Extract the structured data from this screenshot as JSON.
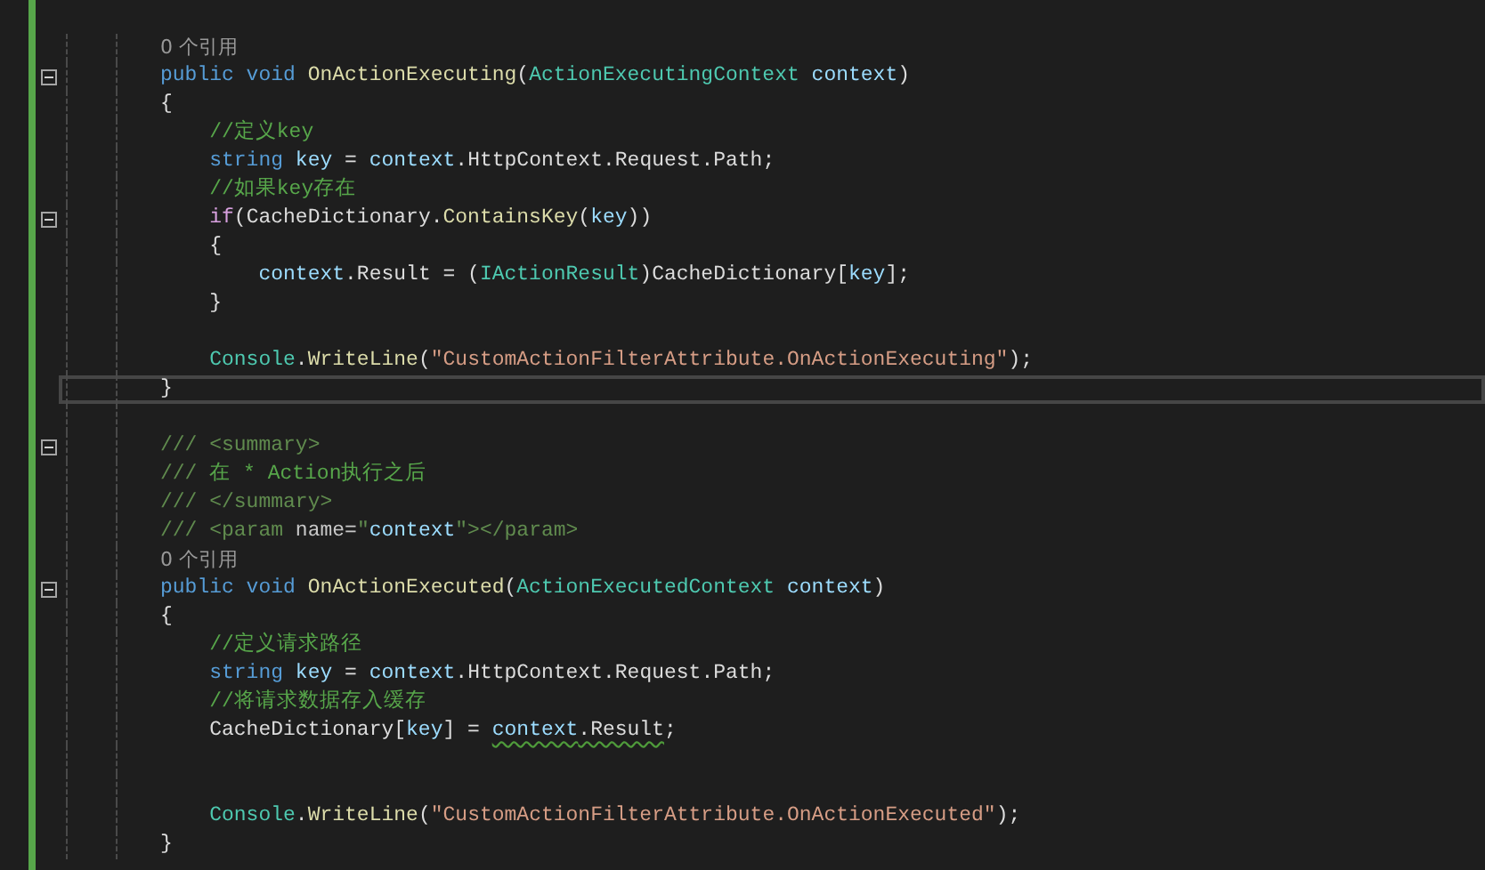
{
  "editor": {
    "lines": [
      {
        "kind": "codelens",
        "text": "0 个引用",
        "fold": false,
        "current": false
      },
      {
        "kind": "code",
        "fold": true,
        "current": false,
        "tokens": [
          {
            "kind": "keyword",
            "text": "public void "
          },
          {
            "kind": "method",
            "text": "OnActionExecuting"
          },
          {
            "kind": "plain",
            "text": "("
          },
          {
            "kind": "type",
            "text": "ActionExecutingContext "
          },
          {
            "kind": "variable",
            "text": "context"
          },
          {
            "kind": "plain",
            "text": ")"
          }
        ]
      },
      {
        "kind": "code",
        "fold": false,
        "current": false,
        "tokens": [
          {
            "kind": "plain",
            "text": "{"
          }
        ]
      },
      {
        "kind": "code",
        "fold": false,
        "current": false,
        "tokens": [
          {
            "kind": "comment",
            "text": "    //定义key"
          }
        ]
      },
      {
        "kind": "code",
        "fold": false,
        "current": false,
        "tokens": [
          {
            "kind": "keyword",
            "text": "    string "
          },
          {
            "kind": "variable",
            "text": "key"
          },
          {
            "kind": "plain",
            "text": " = "
          },
          {
            "kind": "variable",
            "text": "context"
          },
          {
            "kind": "plain",
            "text": ".HttpContext.Request.Path;"
          }
        ]
      },
      {
        "kind": "code",
        "fold": false,
        "current": false,
        "tokens": [
          {
            "kind": "comment",
            "text": "    //如果key存在"
          }
        ]
      },
      {
        "kind": "code",
        "fold": true,
        "current": false,
        "tokens": [
          {
            "kind": "control",
            "text": "    if"
          },
          {
            "kind": "plain",
            "text": "(CacheDictionary."
          },
          {
            "kind": "method",
            "text": "ContainsKey"
          },
          {
            "kind": "plain",
            "text": "("
          },
          {
            "kind": "variable",
            "text": "key"
          },
          {
            "kind": "plain",
            "text": "))"
          }
        ]
      },
      {
        "kind": "code",
        "fold": false,
        "current": false,
        "tokens": [
          {
            "kind": "plain",
            "text": "    {"
          }
        ]
      },
      {
        "kind": "code",
        "fold": false,
        "current": false,
        "tokens": [
          {
            "kind": "variable",
            "text": "        context"
          },
          {
            "kind": "plain",
            "text": ".Result = ("
          },
          {
            "kind": "type",
            "text": "IActionResult"
          },
          {
            "kind": "plain",
            "text": ")CacheDictionary["
          },
          {
            "kind": "variable",
            "text": "key"
          },
          {
            "kind": "plain",
            "text": "];"
          }
        ]
      },
      {
        "kind": "code",
        "fold": false,
        "current": false,
        "tokens": [
          {
            "kind": "plain",
            "text": "    }"
          }
        ]
      },
      {
        "kind": "blank",
        "fold": false,
        "current": false
      },
      {
        "kind": "code",
        "fold": false,
        "current": false,
        "tokens": [
          {
            "kind": "type",
            "text": "    Console"
          },
          {
            "kind": "plain",
            "text": "."
          },
          {
            "kind": "method",
            "text": "WriteLine"
          },
          {
            "kind": "plain",
            "text": "("
          },
          {
            "kind": "string",
            "text": "\"CustomActionFilterAttribute.OnActionExecuting\""
          },
          {
            "kind": "plain",
            "text": ");"
          }
        ]
      },
      {
        "kind": "code",
        "fold": false,
        "current": true,
        "tokens": [
          {
            "kind": "plain",
            "text": "}"
          }
        ]
      },
      {
        "kind": "blank",
        "fold": false,
        "current": false
      },
      {
        "kind": "code",
        "fold": true,
        "current": false,
        "tokens": [
          {
            "kind": "doc",
            "text": "/// <summary>"
          }
        ]
      },
      {
        "kind": "code",
        "fold": false,
        "current": false,
        "tokens": [
          {
            "kind": "doc",
            "text": "/// "
          },
          {
            "kind": "comment",
            "text": "在 * Action执行之后"
          }
        ]
      },
      {
        "kind": "code",
        "fold": false,
        "current": false,
        "tokens": [
          {
            "kind": "doc",
            "text": "/// </summary>"
          }
        ]
      },
      {
        "kind": "code",
        "fold": false,
        "current": false,
        "tokens": [
          {
            "kind": "doc",
            "text": "/// <param "
          },
          {
            "kind": "attr",
            "text": "name="
          },
          {
            "kind": "doc",
            "text": "\""
          },
          {
            "kind": "variable",
            "text": "context"
          },
          {
            "kind": "doc",
            "text": "\"></param>"
          }
        ]
      },
      {
        "kind": "codelens",
        "text": "0 个引用",
        "fold": false,
        "current": false
      },
      {
        "kind": "code",
        "fold": true,
        "current": false,
        "tokens": [
          {
            "kind": "keyword",
            "text": "public void "
          },
          {
            "kind": "method",
            "text": "OnActionExecuted"
          },
          {
            "kind": "plain",
            "text": "("
          },
          {
            "kind": "type",
            "text": "ActionExecutedContext "
          },
          {
            "kind": "variable",
            "text": "context"
          },
          {
            "kind": "plain",
            "text": ")"
          }
        ]
      },
      {
        "kind": "code",
        "fold": false,
        "current": false,
        "tokens": [
          {
            "kind": "plain",
            "text": "{"
          }
        ]
      },
      {
        "kind": "code",
        "fold": false,
        "current": false,
        "tokens": [
          {
            "kind": "comment",
            "text": "    //定义请求路径"
          }
        ]
      },
      {
        "kind": "code",
        "fold": false,
        "current": false,
        "tokens": [
          {
            "kind": "keyword",
            "text": "    string "
          },
          {
            "kind": "variable",
            "text": "key"
          },
          {
            "kind": "plain",
            "text": " = "
          },
          {
            "kind": "variable",
            "text": "context"
          },
          {
            "kind": "plain",
            "text": ".HttpContext.Request.Path;"
          }
        ]
      },
      {
        "kind": "code",
        "fold": false,
        "current": false,
        "tokens": [
          {
            "kind": "comment",
            "text": "    //将请求数据存入缓存"
          }
        ]
      },
      {
        "kind": "code",
        "fold": false,
        "current": false,
        "tokens": [
          {
            "kind": "plain",
            "text": "    CacheDictionary["
          },
          {
            "kind": "variable",
            "text": "key"
          },
          {
            "kind": "plain",
            "text": "] = "
          },
          {
            "kind": "variable",
            "text": "context",
            "squiggle": true
          },
          {
            "kind": "plain",
            "text": ".Result",
            "squiggle": true
          },
          {
            "kind": "plain",
            "text": ";"
          }
        ]
      },
      {
        "kind": "blank",
        "fold": false,
        "current": false
      },
      {
        "kind": "blank",
        "fold": false,
        "current": false
      },
      {
        "kind": "code",
        "fold": false,
        "current": false,
        "tokens": [
          {
            "kind": "type",
            "text": "    Console"
          },
          {
            "kind": "plain",
            "text": "."
          },
          {
            "kind": "method",
            "text": "WriteLine"
          },
          {
            "kind": "plain",
            "text": "("
          },
          {
            "kind": "string",
            "text": "\"CustomActionFilterAttribute.OnActionExecuted\""
          },
          {
            "kind": "plain",
            "text": ");"
          }
        ]
      },
      {
        "kind": "code",
        "fold": false,
        "current": false,
        "tokens": [
          {
            "kind": "plain",
            "text": "}"
          }
        ]
      }
    ]
  }
}
